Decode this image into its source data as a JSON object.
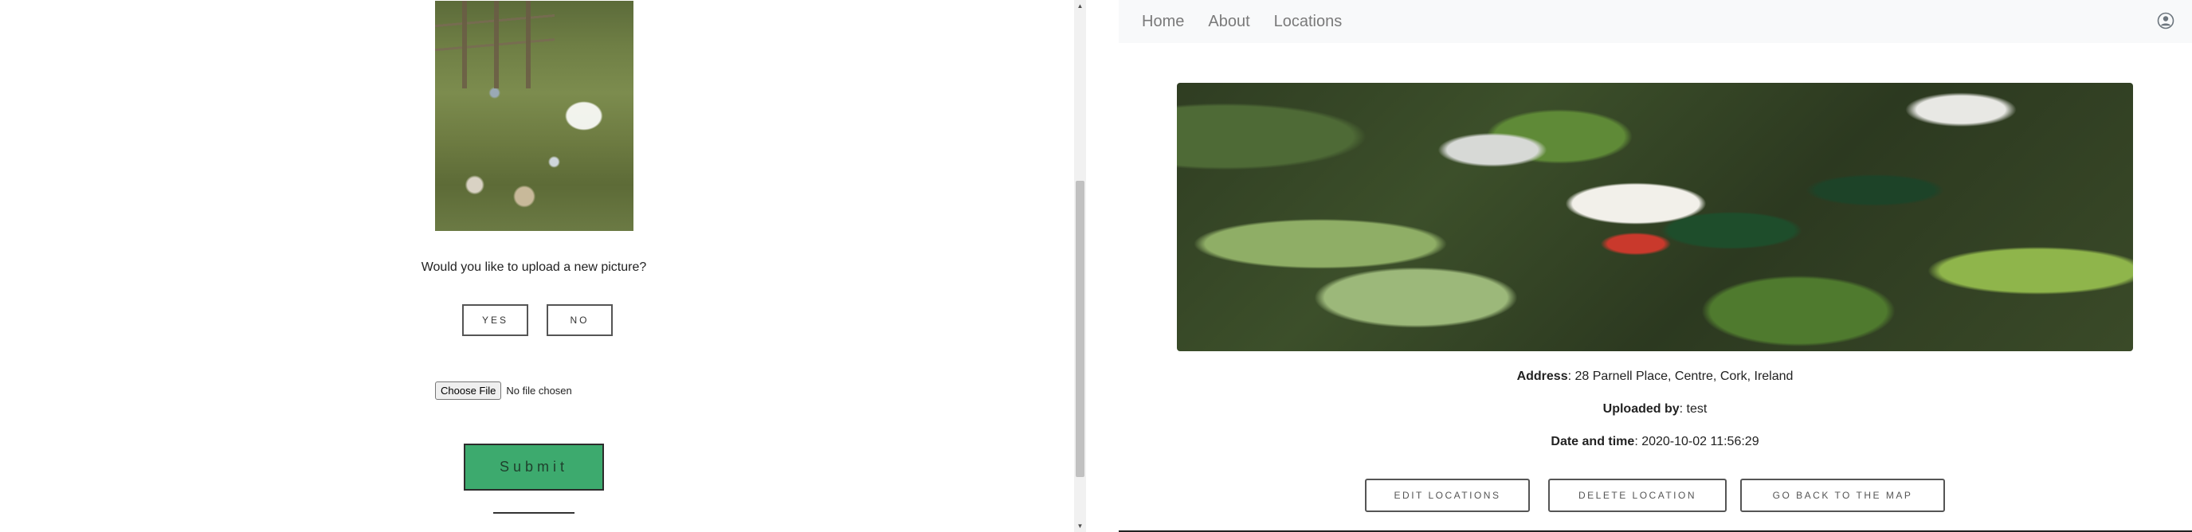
{
  "left": {
    "upload_question": "Would you like to upload a new picture?",
    "yes_label": "YES",
    "no_label": "NO",
    "choose_file_label": "Choose File",
    "file_status": "No file chosen",
    "submit_label": "Submit"
  },
  "right": {
    "nav": {
      "items": [
        {
          "label": "Home"
        },
        {
          "label": "About"
        },
        {
          "label": "Locations"
        }
      ],
      "user_icon": "user-circle-icon"
    },
    "details": {
      "address_label": "Address",
      "address_value": ": 28 Parnell Place, Centre, Cork, Ireland",
      "uploader_label": "Uploaded by",
      "uploader_value": ": test",
      "datetime_label": "Date and time",
      "datetime_value": ": 2020-10-02 11:56:29"
    },
    "actions": {
      "edit": "Edit Locations",
      "delete": "Delete Location",
      "back": "Go back to the map"
    }
  },
  "colors": {
    "submit_green": "#3daa6e",
    "navbar_bg": "#f8f9fa",
    "nav_text": "#7a7a7a"
  }
}
